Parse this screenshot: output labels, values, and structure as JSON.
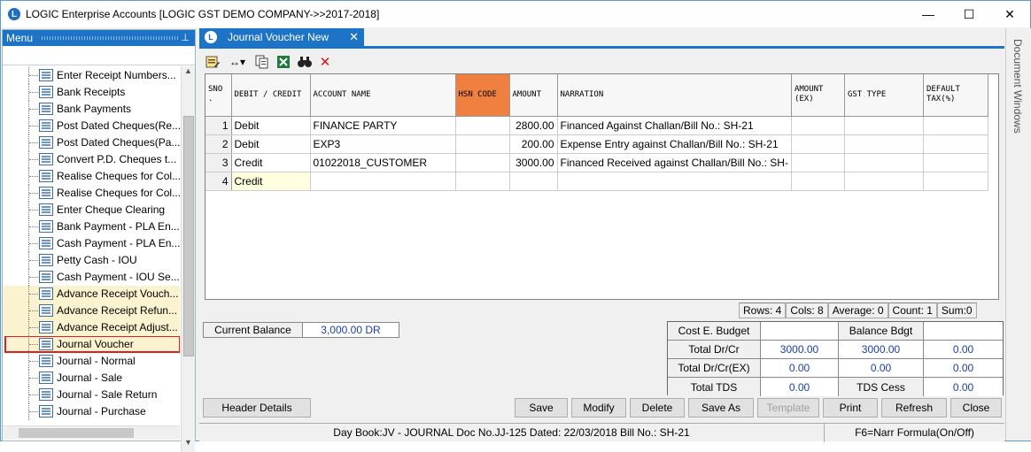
{
  "window": {
    "title": "LOGIC Enterprise Accounts  [LOGIC GST DEMO COMPANY->>2017-2018]",
    "logo_letter": "L",
    "minimize": "—",
    "maximize": "☐",
    "close": "✕"
  },
  "menu": {
    "header": "Menu",
    "pin": "⊥",
    "items": [
      {
        "label": "Enter Receipt Numbers..."
      },
      {
        "label": "Bank Receipts"
      },
      {
        "label": "Bank Payments"
      },
      {
        "label": "Post Dated Cheques(Re..."
      },
      {
        "label": "Post Dated Cheques(Pa..."
      },
      {
        "label": "Convert P.D. Cheques t..."
      },
      {
        "label": "Realise Cheques for Col..."
      },
      {
        "label": "Realise Cheques for Col..."
      },
      {
        "label": "Enter Cheque Clearing"
      },
      {
        "label": "Bank Payment - PLA En..."
      },
      {
        "label": "Cash Payment - PLA En..."
      },
      {
        "label": "Petty Cash - IOU"
      },
      {
        "label": "Cash Payment - IOU Se..."
      },
      {
        "label": "Advance Receipt Vouch..."
      },
      {
        "label": "Advance Receipt Refun..."
      },
      {
        "label": "Advance Receipt Adjust..."
      },
      {
        "label": "Journal Voucher"
      },
      {
        "label": "Journal - Normal"
      },
      {
        "label": "Journal - Sale"
      },
      {
        "label": "Journal - Sale Return"
      },
      {
        "label": "Journal - Purchase"
      }
    ],
    "scroll_up": "▲",
    "scroll_down": "▼"
  },
  "tab": {
    "label": "Journal Voucher New",
    "close": "✕",
    "icon_letter": "L"
  },
  "doc_windows": "Document Windows",
  "toolbar": {
    "icons": [
      "edit-note-icon",
      "arrows-icon",
      "copy-icon",
      "excel-icon",
      "find-icon",
      "delete-icon"
    ],
    "arrows_glyph": "↔▾",
    "find_glyph": "⛶",
    "delete_glyph": "✕"
  },
  "grid": {
    "columns": [
      "SNO .",
      "DEBIT / CREDIT",
      "ACCOUNT NAME",
      "HSN CODE",
      "AMOUNT",
      "NARRATION",
      "AMOUNT (EX)",
      "GST TYPE",
      "DEFAULT TAX(%)"
    ],
    "rows": [
      {
        "sno": "1",
        "dc": "Debit",
        "account": "FINANCE PARTY",
        "hsn": "",
        "amount": "2800.00",
        "narration": "Financed Against Challan/Bill No.: SH-21",
        "amount_ex": "",
        "gst": "",
        "tax": ""
      },
      {
        "sno": "2",
        "dc": "Debit",
        "account": "EXP3",
        "hsn": "",
        "amount": "200.00",
        "narration": "Expense Entry against Challan/Bill No.: SH-21",
        "amount_ex": "",
        "gst": "",
        "tax": ""
      },
      {
        "sno": "3",
        "dc": "Credit",
        "account": "01022018_CUSTOMER",
        "hsn": "",
        "amount": "3000.00",
        "narration": "Financed Received against Challan/Bill No.: SH-",
        "amount_ex": "",
        "gst": "",
        "tax": ""
      },
      {
        "sno": "4",
        "dc": "Credit",
        "account": "",
        "hsn": "",
        "amount": "",
        "narration": "",
        "amount_ex": "",
        "gst": "",
        "tax": ""
      }
    ]
  },
  "status": {
    "rows": "Rows: 4",
    "cols": "Cols: 8",
    "average": "Average: 0",
    "count": "Count: 1",
    "sum": "Sum:0"
  },
  "balance": {
    "label": "Current Balance",
    "value": "3,000.00 DR"
  },
  "summary": {
    "cost_budget": "Cost E. Budget",
    "balance_bdgt": "Balance Bdgt",
    "total_drcr": "Total Dr/Cr",
    "total_drcr_v1": "3000.00",
    "total_drcr_v2": "3000.00",
    "total_drcr_v3": "0.00",
    "total_drcr_ex": "Total Dr/Cr(EX)",
    "ex_v1": "0.00",
    "ex_v2": "0.00",
    "ex_v3": "0.00",
    "total_tds": "Total TDS",
    "tds_v": "0.00",
    "tds_cess": "TDS Cess",
    "tds_cess_v": "0.00"
  },
  "buttons": {
    "header_details": "Header Details",
    "save": "Save",
    "modify": "Modify",
    "delete": "Delete",
    "save_as": "Save As",
    "template": "Template",
    "print": "Print",
    "refresh": "Refresh",
    "close": "Close"
  },
  "footer": {
    "info": "Day Book:JV - JOURNAL Doc No.JJ-125 Dated: 22/03/2018 Bill No.: SH-21",
    "f6": "F6=Narr Formula(On/Off)"
  }
}
